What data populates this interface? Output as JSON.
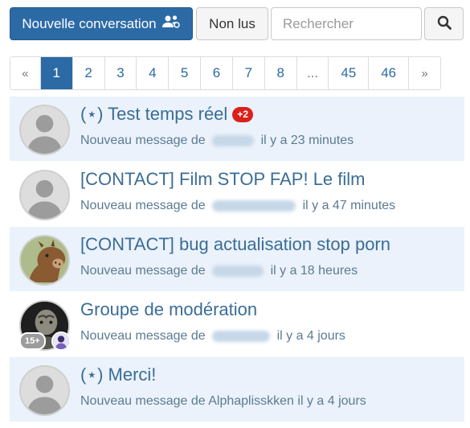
{
  "toolbar": {
    "new_conversation_label": "Nouvelle conversation",
    "unread_label": "Non lus",
    "search_placeholder": "Rechercher",
    "accent_color": "#2c6aa6"
  },
  "pagination": {
    "prev": "«",
    "next": "»",
    "pages": [
      "1",
      "2",
      "3",
      "4",
      "5",
      "6",
      "7",
      "8",
      "...",
      "45",
      "46"
    ],
    "active_page": "1"
  },
  "conversations": [
    {
      "title": "(⋆) Test temps réel",
      "badge": "+2",
      "meta_prefix": "Nouveau message de",
      "meta_time": "il y a 23 minutes",
      "avatar": "default-user"
    },
    {
      "title": "[CONTACT] Film STOP FAP! Le film",
      "meta_prefix": "Nouveau message de",
      "meta_time": "il y a 47 minutes",
      "avatar": "default-user"
    },
    {
      "title": "[CONTACT] bug actualisation stop porn",
      "meta_prefix": "Nouveau message de",
      "meta_time": "il y a 18 heures",
      "avatar": "horse-mask"
    },
    {
      "title": "Groupe de modération",
      "meta_prefix": "Nouveau message de",
      "meta_time": "il y a 4 jours",
      "avatar": "group-photo",
      "member_count": "15+"
    },
    {
      "title": "(⋆) Merci!",
      "meta_prefix": "Nouveau message de",
      "meta_author": "Alphaplisskken",
      "meta_time": "il y a 4 jours",
      "avatar": "default-user"
    }
  ]
}
